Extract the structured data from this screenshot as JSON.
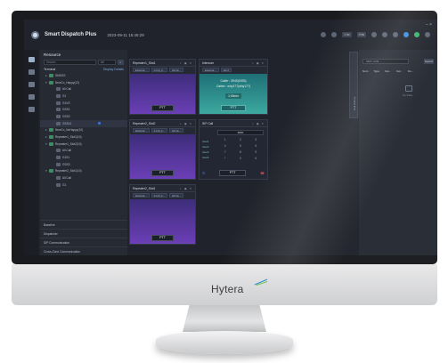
{
  "app": {
    "name": "Smart Dispatch Plus",
    "datetime": "2023-09-11 15:45:29",
    "toolbar_chips": [
      "1 fw",
      "0 fw"
    ]
  },
  "resource_panel": {
    "title": "Resource",
    "search_placeholder": "Search",
    "filter_value": "All",
    "section": "Terminal",
    "display_toggle": "Display Details",
    "tree": [
      {
        "label": "SMSGS",
        "level": 1,
        "arrow": "▸",
        "type": "green"
      },
      {
        "label": "NewCo_Happy(12)",
        "level": 1,
        "arrow": "▾",
        "type": "green"
      },
      {
        "label": "All Call",
        "level": 2,
        "arrow": "",
        "type": "gray"
      },
      {
        "label": "G1",
        "level": 2,
        "arrow": "",
        "type": "gray"
      },
      {
        "label": "G1VS",
        "level": 2,
        "arrow": "",
        "type": "gray"
      },
      {
        "label": "GSS1",
        "level": 2,
        "arrow": "",
        "type": "gray"
      },
      {
        "label": "GSS2",
        "level": 2,
        "arrow": "",
        "type": "gray"
      },
      {
        "label": "GSSL2",
        "level": 2,
        "arrow": "",
        "type": "gray",
        "selected": true
      },
      {
        "label": "NewCo_NoHappy(10)",
        "level": 1,
        "arrow": "▸",
        "type": "green"
      },
      {
        "label": "Repeater1_Slot1(10)",
        "level": 1,
        "arrow": "▸",
        "type": "green"
      },
      {
        "label": "Repeater1_Slot2(10)",
        "level": 1,
        "arrow": "▾",
        "type": "green"
      },
      {
        "label": "All Call",
        "level": 2,
        "arrow": "",
        "type": "gray"
      },
      {
        "label": "G1S1",
        "level": 2,
        "arrow": "",
        "type": "gray"
      },
      {
        "label": "GSS3",
        "level": 2,
        "arrow": "",
        "type": "gray"
      },
      {
        "label": "Repeater2_Slot1(10)",
        "level": 1,
        "arrow": "▾",
        "type": "green"
      },
      {
        "label": "All Call",
        "level": 2,
        "arrow": "",
        "type": "gray"
      },
      {
        "label": "G1",
        "level": 2,
        "arrow": "",
        "type": "gray"
      }
    ],
    "bottom_sections": [
      "Baseline",
      "Dispatcher",
      "SIP Communication",
      "Cross-Zone Communication"
    ]
  },
  "cards": [
    {
      "title": "Repeater1_Slot1",
      "pills": [
        "External...",
        "A L(N_2...",
        "All Ca..."
      ],
      "ptt": "PTT"
    },
    {
      "title": "Intercom",
      "pills": [
        "External...",
        "who7"
      ],
      "ptt": "PTT",
      "caller": "Caller : 3945(0393)",
      "callee": "Callee : why177(why177)",
      "call_time": "1:00min"
    },
    {
      "title": "Repeater2_Slot2",
      "pills": [
        "External...",
        "A L(N_2...",
        "All Ca..."
      ],
      "ptt": "PTT"
    },
    {
      "title": "SIP Call",
      "display": "9800",
      "keys": [
        "1",
        "2",
        "3",
        "4",
        "5",
        "6",
        "7",
        "8",
        "9",
        "*",
        "0",
        "#"
      ],
      "list": [
        "User1",
        "User2",
        "User3",
        "User4"
      ],
      "ptt": "PTT"
    },
    {
      "title": "Repeater2_Slot1",
      "pills": [
        "External...",
        "A L(N_2...",
        "All Ca..."
      ],
      "ptt": "PTT"
    }
  ],
  "side_tab": "Call History",
  "right_panel": {
    "search_placeholder": "9805 1999 ...",
    "search_button": "Search",
    "columns": [
      "Num",
      "Type",
      "Cal...",
      "Cal...",
      "Du..."
    ],
    "empty_text": "No Data"
  },
  "brand": "Hytera"
}
